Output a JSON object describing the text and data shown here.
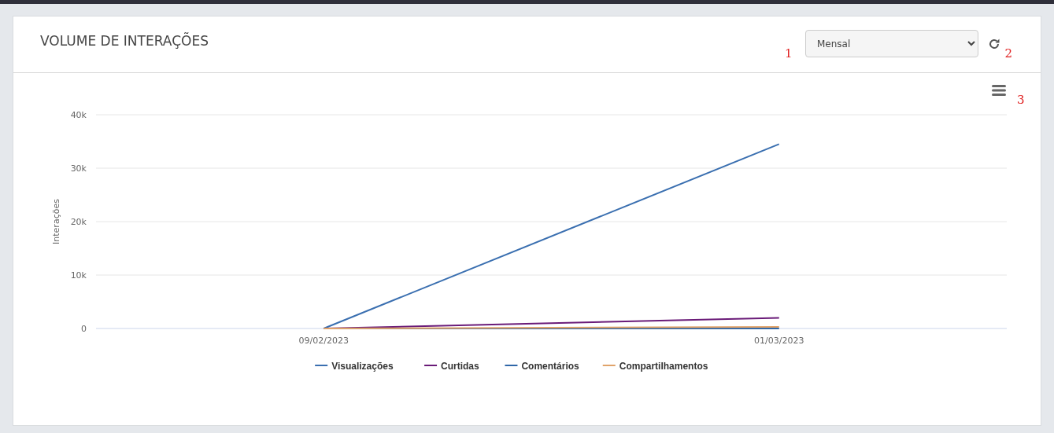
{
  "card": {
    "title": "VOLUME DE INTERAÇÕES",
    "select_marker": "1",
    "period_select": {
      "value": "Mensal"
    },
    "refresh_marker": "2",
    "menu_marker": "3",
    "chart_data": {
      "type": "line",
      "grid": true,
      "legend": "bottom",
      "ylabel": "Interações",
      "categories": [
        "09/02/2023",
        "01/03/2023"
      ],
      "ylim": [
        0,
        40000
      ],
      "yticks": [
        {
          "value": 0,
          "label": "0"
        },
        {
          "value": 10000,
          "label": "10k"
        },
        {
          "value": 20000,
          "label": "20k"
        },
        {
          "value": 30000,
          "label": "30k"
        },
        {
          "value": 40000,
          "label": "40k"
        }
      ],
      "series": [
        {
          "name": "Visualizações",
          "color": "#3a6fb0",
          "values": [
            0,
            34500
          ]
        },
        {
          "name": "Curtidas",
          "color": "#6a1b78",
          "values": [
            0,
            2000
          ]
        },
        {
          "name": "Comentários",
          "color": "#2f67a8",
          "values": [
            0,
            0
          ]
        },
        {
          "name": "Compartilhamentos",
          "color": "#e0a36a",
          "values": [
            0,
            300
          ]
        }
      ]
    }
  }
}
